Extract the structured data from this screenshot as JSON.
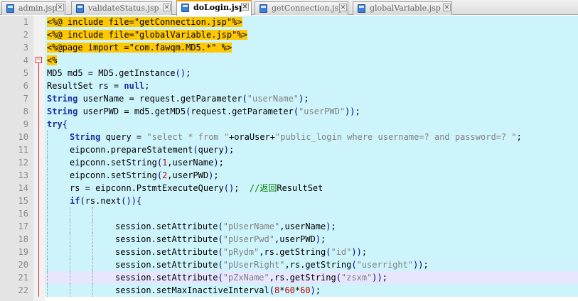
{
  "tabs": [
    {
      "label": "admin.jsp",
      "close": "✕",
      "active": false
    },
    {
      "label": "validateStatus.jsp",
      "close": "✕",
      "active": false
    },
    {
      "label": "doLogin.jsp",
      "close": "✕",
      "active": true
    },
    {
      "label": "getConnection.jsp",
      "close": "✕",
      "active": false
    },
    {
      "label": "globalVariable.jsp",
      "close": "✕",
      "active": false
    }
  ],
  "colors": {
    "line_bg": "#cdf4fb",
    "current_line_bg": "#e6e6ff",
    "directive_highlight": "#ffc800",
    "keyword": "#1d2fa0",
    "string": "#808080",
    "number": "#d00000",
    "comment": "#008000"
  },
  "current_line": 21,
  "fold_line": 4,
  "fold_symbol": "−",
  "lines": [
    {
      "n": "1",
      "indent": 0,
      "tokens": [
        {
          "t": "<%@ include file=\"getConnection.jsp\"%>",
          "c": "hl"
        }
      ]
    },
    {
      "n": "2",
      "indent": 0,
      "tokens": [
        {
          "t": "<%@ include file=\"globalVariable.jsp\"%>",
          "c": "hl"
        }
      ]
    },
    {
      "n": "3",
      "indent": 0,
      "tokens": [
        {
          "t": "<%@page import =\"com.fawqm.MD5.*\" %>",
          "c": "hl"
        }
      ]
    },
    {
      "n": "4",
      "indent": 0,
      "tokens": [
        {
          "t": "<%",
          "c": "hl"
        }
      ]
    },
    {
      "n": "5",
      "indent": 0,
      "tokens": [
        {
          "t": "MD5 md5 = MD5.getInstance"
        },
        {
          "t": "()",
          "c": "op"
        },
        {
          "t": ";"
        }
      ]
    },
    {
      "n": "6",
      "indent": 0,
      "tokens": [
        {
          "t": "ResultSet rs = "
        },
        {
          "t": "null",
          "c": "kw"
        },
        {
          "t": ";"
        }
      ]
    },
    {
      "n": "7",
      "indent": 0,
      "tokens": [
        {
          "t": "String",
          "c": "kw"
        },
        {
          "t": " userName = request.getParameter"
        },
        {
          "t": "(",
          "c": "op"
        },
        {
          "t": "\"userName\"",
          "c": "str"
        },
        {
          "t": ")",
          "c": "op"
        },
        {
          "t": ";"
        }
      ]
    },
    {
      "n": "8",
      "indent": 0,
      "tokens": [
        {
          "t": "String",
          "c": "kw"
        },
        {
          "t": " userPWD = md5.getMD5"
        },
        {
          "t": "(",
          "c": "op"
        },
        {
          "t": "request.getParameter"
        },
        {
          "t": "(",
          "c": "op"
        },
        {
          "t": "\"userPWD\"",
          "c": "str"
        },
        {
          "t": "))",
          "c": "op"
        },
        {
          "t": ";"
        }
      ]
    },
    {
      "n": "9",
      "indent": 0,
      "tokens": [
        {
          "t": "try",
          "c": "kw"
        },
        {
          "t": "{",
          "c": "op"
        }
      ]
    },
    {
      "n": "10",
      "indent": 1,
      "tokens": [
        {
          "t": "String",
          "c": "kw"
        },
        {
          "t": " query = "
        },
        {
          "t": "\"select * from \"",
          "c": "str"
        },
        {
          "t": "+oraUser+"
        },
        {
          "t": "\"public_login where username=? and password=? \"",
          "c": "str"
        },
        {
          "t": ";"
        }
      ]
    },
    {
      "n": "11",
      "indent": 1,
      "tokens": [
        {
          "t": "eipconn.prepareStatement"
        },
        {
          "t": "(",
          "c": "op"
        },
        {
          "t": "query"
        },
        {
          "t": ")",
          "c": "op"
        },
        {
          "t": ";"
        }
      ]
    },
    {
      "n": "12",
      "indent": 1,
      "tokens": [
        {
          "t": "eipconn.setString"
        },
        {
          "t": "(",
          "c": "op"
        },
        {
          "t": "1",
          "c": "num"
        },
        {
          "t": ",userName"
        },
        {
          "t": ")",
          "c": "op"
        },
        {
          "t": ";"
        }
      ]
    },
    {
      "n": "13",
      "indent": 1,
      "tokens": [
        {
          "t": "eipconn.setString"
        },
        {
          "t": "(",
          "c": "op"
        },
        {
          "t": "2",
          "c": "num"
        },
        {
          "t": ",userPWD"
        },
        {
          "t": ")",
          "c": "op"
        },
        {
          "t": ";"
        }
      ]
    },
    {
      "n": "14",
      "indent": 1,
      "tokens": [
        {
          "t": "rs = eipconn.PstmtExecuteQuery"
        },
        {
          "t": "()",
          "c": "op"
        },
        {
          "t": ";  "
        },
        {
          "t": "//返回",
          "c": "cmt"
        },
        {
          "t": "ResultSet"
        }
      ]
    },
    {
      "n": "15",
      "indent": 1,
      "tokens": [
        {
          "t": "if",
          "c": "kw"
        },
        {
          "t": "(",
          "c": "op"
        },
        {
          "t": "rs.next"
        },
        {
          "t": "()){",
          "c": "op"
        }
      ]
    },
    {
      "n": "16",
      "indent": 3,
      "tokens": []
    },
    {
      "n": "17",
      "indent": 3,
      "tokens": [
        {
          "t": "session.setAttribute"
        },
        {
          "t": "(",
          "c": "op"
        },
        {
          "t": "\"pUserName\"",
          "c": "str"
        },
        {
          "t": ",userName"
        },
        {
          "t": ")",
          "c": "op"
        },
        {
          "t": ";"
        }
      ]
    },
    {
      "n": "18",
      "indent": 3,
      "tokens": [
        {
          "t": "session.setAttribute"
        },
        {
          "t": "(",
          "c": "op"
        },
        {
          "t": "\"pUserPwd\"",
          "c": "str"
        },
        {
          "t": ",userPWD"
        },
        {
          "t": ")",
          "c": "op"
        },
        {
          "t": ";"
        }
      ]
    },
    {
      "n": "19",
      "indent": 3,
      "tokens": [
        {
          "t": "session.setAttribute"
        },
        {
          "t": "(",
          "c": "op"
        },
        {
          "t": "\"pRydm\"",
          "c": "str"
        },
        {
          "t": ",rs.getString"
        },
        {
          "t": "(",
          "c": "op"
        },
        {
          "t": "\"id\"",
          "c": "str"
        },
        {
          "t": "))",
          "c": "op"
        },
        {
          "t": ";"
        }
      ]
    },
    {
      "n": "20",
      "indent": 3,
      "tokens": [
        {
          "t": "session.setAttribute"
        },
        {
          "t": "(",
          "c": "op"
        },
        {
          "t": "\"pUserRight\"",
          "c": "str"
        },
        {
          "t": ",rs.getString"
        },
        {
          "t": "(",
          "c": "op"
        },
        {
          "t": "\"userright\"",
          "c": "str"
        },
        {
          "t": "))",
          "c": "op"
        },
        {
          "t": ";"
        }
      ]
    },
    {
      "n": "21",
      "indent": 3,
      "tokens": [
        {
          "t": "session.setAttribute"
        },
        {
          "t": "(",
          "c": "op"
        },
        {
          "t": "\"pZxName\"",
          "c": "str"
        },
        {
          "t": ",rs.getString"
        },
        {
          "t": "(",
          "c": "op"
        },
        {
          "t": "\"zsxm\"",
          "c": "str"
        },
        {
          "t": "))",
          "c": "op"
        },
        {
          "t": ";"
        }
      ]
    },
    {
      "n": "22",
      "indent": 3,
      "tokens": [
        {
          "t": "session.setMaxInactiveInterval"
        },
        {
          "t": "(",
          "c": "op"
        },
        {
          "t": "8",
          "c": "num"
        },
        {
          "t": "*"
        },
        {
          "t": "60",
          "c": "num"
        },
        {
          "t": "*"
        },
        {
          "t": "60",
          "c": "num"
        },
        {
          "t": ")",
          "c": "op"
        },
        {
          "t": ";"
        }
      ]
    }
  ]
}
